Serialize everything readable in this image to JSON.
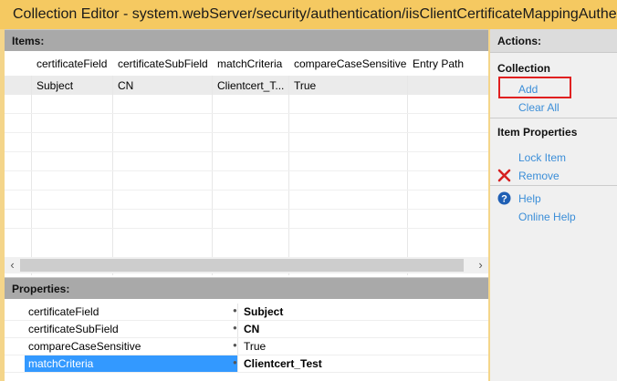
{
  "window": {
    "title": "Collection Editor - system.webServer/security/authentication/iisClientCertificateMappingAuthentication"
  },
  "items_panel": {
    "title": "Items:"
  },
  "grid": {
    "columns": [
      "certificateField",
      "certificateSubField",
      "matchCriteria",
      "compareCaseSensitive",
      "Entry Path"
    ],
    "rows": [
      [
        "Subject",
        "CN",
        "Clientcert_T...",
        "True",
        ""
      ]
    ]
  },
  "properties_panel": {
    "title": "Properties:",
    "rows": [
      {
        "name": "certificateField",
        "value": "Subject",
        "bold": true
      },
      {
        "name": "certificateSubField",
        "value": "CN",
        "bold": true
      },
      {
        "name": "compareCaseSensitive",
        "value": "True",
        "bold": false
      },
      {
        "name": "matchCriteria",
        "value": "Clientcert_Test",
        "bold": true,
        "selected": true
      }
    ]
  },
  "actions": {
    "title": "Actions:",
    "collection_title": "Collection",
    "add": "Add",
    "clear_all": "Clear All",
    "item_properties_title": "Item Properties",
    "lock_item": "Lock Item",
    "remove": "Remove",
    "help": "Help",
    "online_help": "Online Help",
    "link_color": "#3b8ed8",
    "highlight_color": "#e02020"
  }
}
